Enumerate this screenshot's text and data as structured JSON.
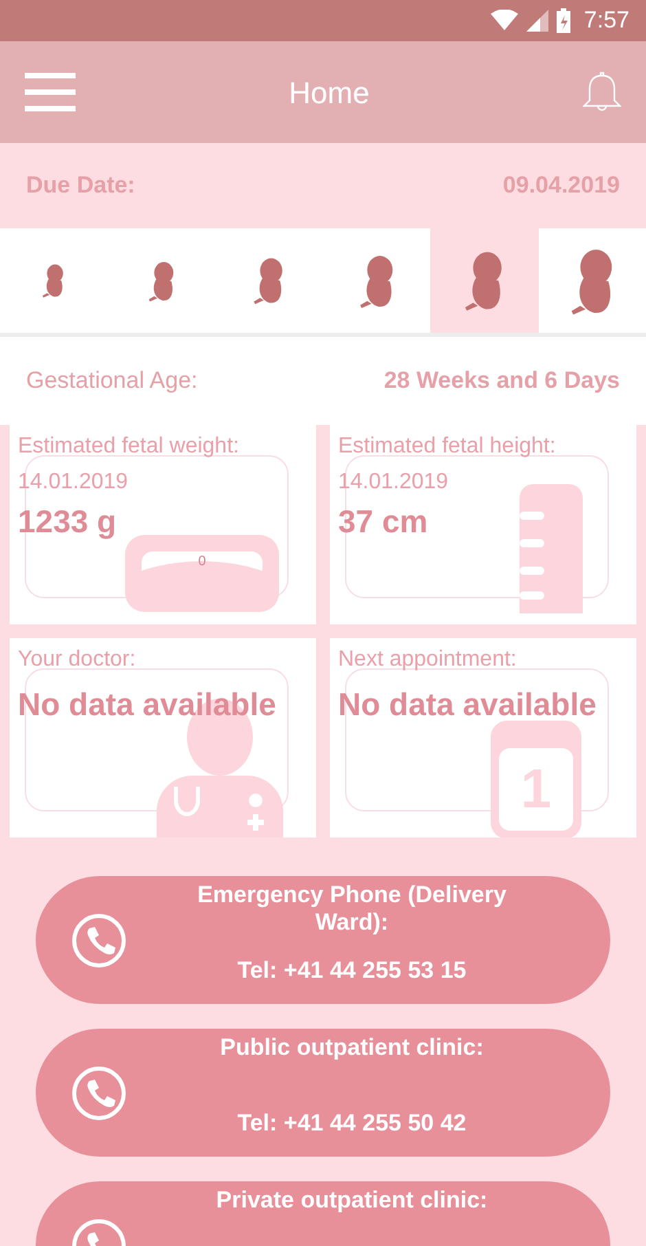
{
  "status_bar": {
    "time": "7:57"
  },
  "app_bar": {
    "title": "Home"
  },
  "due_date": {
    "label": "Due Date:",
    "value": "09.04.2019"
  },
  "fetus_stages": [
    {
      "selected": false
    },
    {
      "selected": false
    },
    {
      "selected": false
    },
    {
      "selected": false
    },
    {
      "selected": true
    },
    {
      "selected": false
    }
  ],
  "gestational_age": {
    "label": "Gestational Age:",
    "value": "28 Weeks and 6 Days"
  },
  "cards": [
    {
      "kind": "weight",
      "label": "Estimated fetal weight:",
      "date": "14.01.2019",
      "value": "1233 g",
      "dial_label": "0"
    },
    {
      "kind": "height",
      "label": "Estimated fetal height:",
      "date": "14.01.2019",
      "value": "37 cm"
    },
    {
      "kind": "doctor",
      "label": "Your doctor:",
      "value": "No data available"
    },
    {
      "kind": "appointment",
      "label": "Next appointment:",
      "value": "No data available",
      "calendar_day": "1"
    }
  ],
  "contacts": [
    {
      "title": "Emergency Phone (Delivery Ward):",
      "phone": "Tel: +41 44 255 53 15"
    },
    {
      "title": "Public outpatient clinic:",
      "phone": "Tel: +41 44 255 50 42"
    },
    {
      "title": "Private outpatient clinic:"
    }
  ]
}
